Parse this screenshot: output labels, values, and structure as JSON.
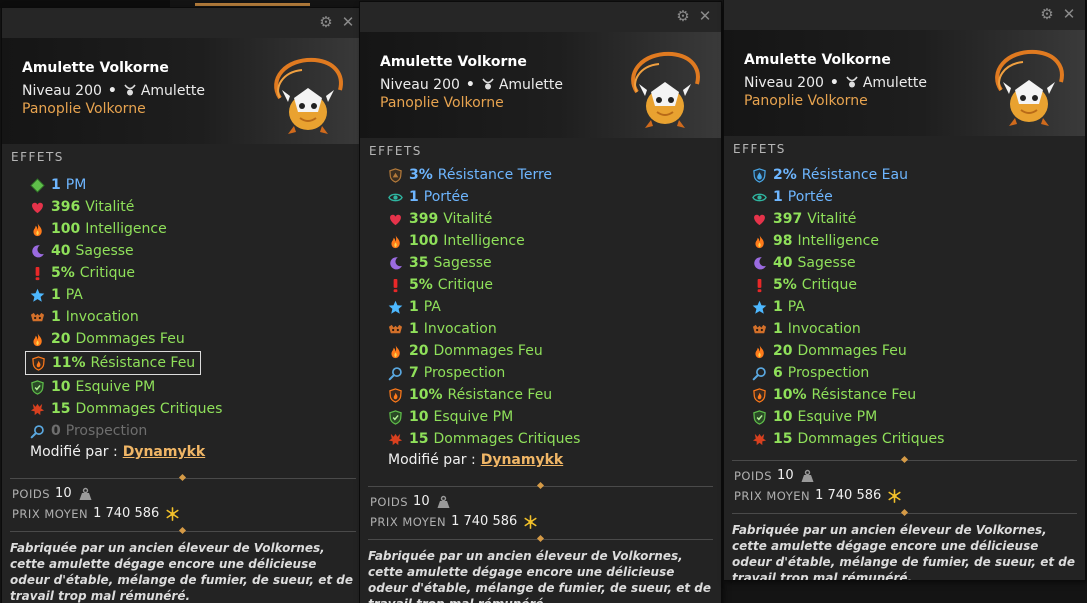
{
  "panels": [
    {
      "item_name": "Amulette Volkorne",
      "level": "Niveau 200",
      "type": "Amulette",
      "set": "Panoplie Volkorne",
      "effects_title": "EFFETS",
      "effects": [
        {
          "value": "1",
          "label": "PM",
          "icon": "pm-diamond-icon",
          "color": "blue"
        },
        {
          "value": "396",
          "label": "Vitalité",
          "icon": "heart-icon",
          "color": "green"
        },
        {
          "value": "100",
          "label": "Intelligence",
          "icon": "fire-icon",
          "color": "green"
        },
        {
          "value": "40",
          "label": "Sagesse",
          "icon": "moon-icon",
          "color": "green"
        },
        {
          "value": "5%",
          "label": "Critique",
          "icon": "exclamation-icon",
          "color": "green"
        },
        {
          "value": "1",
          "label": "PA",
          "icon": "star-icon",
          "color": "green"
        },
        {
          "value": "1",
          "label": "Invocation",
          "icon": "invocation-icon",
          "color": "green"
        },
        {
          "value": "20",
          "label": "Dommages Feu",
          "icon": "fire-icon",
          "color": "green"
        },
        {
          "value": "11%",
          "label": "Résistance Feu",
          "icon": "shield-fire-icon",
          "color": "green",
          "boxed": true
        },
        {
          "value": "10",
          "label": "Esquive PM",
          "icon": "shield-green-icon",
          "color": "green"
        },
        {
          "value": "15",
          "label": "Dommages Critiques",
          "icon": "critical-damage-icon",
          "color": "green"
        },
        {
          "value": "0",
          "label": "Prospection",
          "icon": "magnifier-icon",
          "color": "gray"
        }
      ],
      "modified_label": "Modifié par :",
      "modified_by": "Dynamykk",
      "weight_label": "POIDS",
      "weight": "10",
      "price_label": "PRIX MOYEN",
      "price": "1 740 586",
      "description": "Fabriquée par un ancien éleveur de Volkornes, cette amulette dégage encore une délicieuse odeur d'étable, mélange de fumier, de sueur, et de travail trop mal rémunéré."
    },
    {
      "item_name": "Amulette Volkorne",
      "level": "Niveau 200",
      "type": "Amulette",
      "set": "Panoplie Volkorne",
      "effects_title": "EFFETS",
      "effects": [
        {
          "value": "3%",
          "label": "Résistance Terre",
          "icon": "shield-earth-icon",
          "color": "blue"
        },
        {
          "value": "1",
          "label": "Portée",
          "icon": "eye-icon",
          "color": "blue"
        },
        {
          "value": "399",
          "label": "Vitalité",
          "icon": "heart-icon",
          "color": "green"
        },
        {
          "value": "100",
          "label": "Intelligence",
          "icon": "fire-icon",
          "color": "green"
        },
        {
          "value": "35",
          "label": "Sagesse",
          "icon": "moon-icon",
          "color": "green"
        },
        {
          "value": "5%",
          "label": "Critique",
          "icon": "exclamation-icon",
          "color": "green"
        },
        {
          "value": "1",
          "label": "PA",
          "icon": "star-icon",
          "color": "green"
        },
        {
          "value": "1",
          "label": "Invocation",
          "icon": "invocation-icon",
          "color": "green"
        },
        {
          "value": "20",
          "label": "Dommages Feu",
          "icon": "fire-icon",
          "color": "green"
        },
        {
          "value": "7",
          "label": "Prospection",
          "icon": "magnifier-icon",
          "color": "green"
        },
        {
          "value": "10%",
          "label": "Résistance Feu",
          "icon": "shield-fire-icon",
          "color": "green"
        },
        {
          "value": "10",
          "label": "Esquive PM",
          "icon": "shield-green-icon",
          "color": "green"
        },
        {
          "value": "15",
          "label": "Dommages Critiques",
          "icon": "critical-damage-icon",
          "color": "green"
        }
      ],
      "modified_label": "Modifié par :",
      "modified_by": "Dynamykk",
      "weight_label": "POIDS",
      "weight": "10",
      "price_label": "PRIX MOYEN",
      "price": "1 740 586",
      "description": "Fabriquée par un ancien éleveur de Volkornes, cette amulette dégage encore une délicieuse odeur d'étable, mélange de fumier, de sueur, et de travail trop mal rémunéré."
    },
    {
      "item_name": "Amulette Volkorne",
      "level": "Niveau 200",
      "type": "Amulette",
      "set": "Panoplie Volkorne",
      "effects_title": "EFFETS",
      "effects": [
        {
          "value": "2%",
          "label": "Résistance Eau",
          "icon": "shield-water-icon",
          "color": "blue"
        },
        {
          "value": "1",
          "label": "Portée",
          "icon": "eye-icon",
          "color": "blue"
        },
        {
          "value": "397",
          "label": "Vitalité",
          "icon": "heart-icon",
          "color": "green"
        },
        {
          "value": "98",
          "label": "Intelligence",
          "icon": "fire-icon",
          "color": "green"
        },
        {
          "value": "40",
          "label": "Sagesse",
          "icon": "moon-icon",
          "color": "green"
        },
        {
          "value": "5%",
          "label": "Critique",
          "icon": "exclamation-icon",
          "color": "green"
        },
        {
          "value": "1",
          "label": "PA",
          "icon": "star-icon",
          "color": "green"
        },
        {
          "value": "1",
          "label": "Invocation",
          "icon": "invocation-icon",
          "color": "green"
        },
        {
          "value": "20",
          "label": "Dommages Feu",
          "icon": "fire-icon",
          "color": "green"
        },
        {
          "value": "6",
          "label": "Prospection",
          "icon": "magnifier-icon",
          "color": "green"
        },
        {
          "value": "10%",
          "label": "Résistance Feu",
          "icon": "shield-fire-icon",
          "color": "green"
        },
        {
          "value": "10",
          "label": "Esquive PM",
          "icon": "shield-green-icon",
          "color": "green"
        },
        {
          "value": "15",
          "label": "Dommages Critiques",
          "icon": "critical-damage-icon",
          "color": "green"
        }
      ],
      "weight_label": "POIDS",
      "weight": "10",
      "price_label": "PRIX MOYEN",
      "price": "1 740 586",
      "description": "Fabriquée par un ancien éleveur de Volkornes, cette amulette dégage encore une délicieuse odeur d'étable, mélange de fumier, de sueur, et de travail trop mal rémunéré."
    }
  ],
  "colors": {
    "effect_green": "#8fe05a",
    "effect_blue": "#6eb6ff",
    "effect_gray": "#6e6e6e",
    "set_orange": "#e7a34f",
    "author_orange": "#f0b666"
  }
}
